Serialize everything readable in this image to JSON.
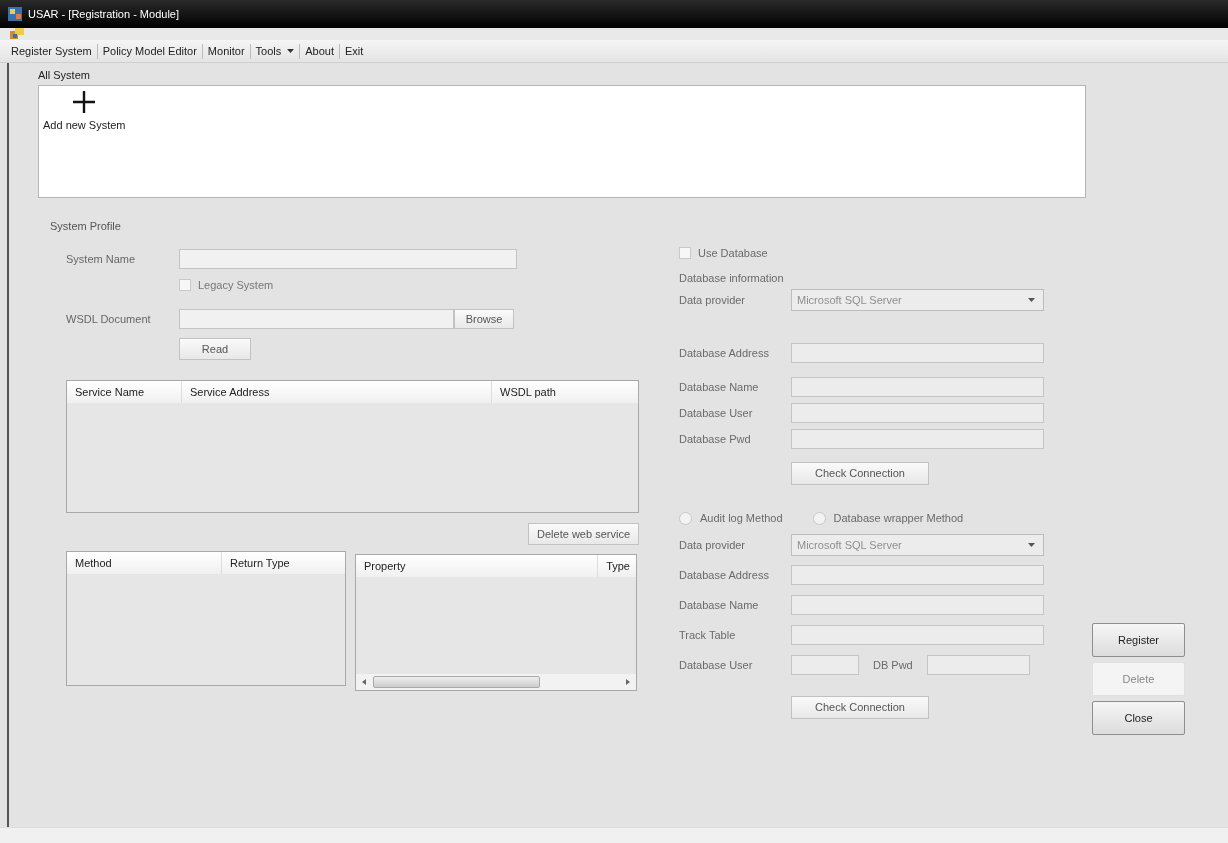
{
  "window": {
    "title": "USAR - [Registration - Module]"
  },
  "menu": [
    {
      "label": "Register System",
      "dropdown": false
    },
    {
      "label": "Policy Model Editor",
      "dropdown": false
    },
    {
      "label": "Monitor",
      "dropdown": false
    },
    {
      "label": "Tools",
      "dropdown": true
    },
    {
      "label": "About",
      "dropdown": false
    },
    {
      "label": "Exit",
      "dropdown": false
    }
  ],
  "all_system": {
    "title": "All System",
    "add_label": "Add new System"
  },
  "system_profile": {
    "title": "System Profile",
    "system_name": {
      "label": "System Name"
    },
    "legacy": {
      "label": "Legacy System",
      "checked": false
    },
    "wsdl": {
      "label": "WSDL Document",
      "browse": "Browse"
    },
    "read_button": "Read",
    "services_table": {
      "columns": [
        "Service Name",
        "Service Address",
        "WSDL path"
      ]
    },
    "delete_service_button": "Delete web service",
    "methods_table": {
      "columns": [
        "Method",
        "Return Type"
      ]
    },
    "properties_table": {
      "columns": [
        "Property",
        "Type"
      ]
    }
  },
  "database": {
    "use_database": {
      "label": "Use Database",
      "checked": false
    },
    "info_title": "Database information",
    "provider": {
      "label": "Data provider",
      "value": "Microsoft SQL Server"
    },
    "fields": [
      "Database Address",
      "Database Name",
      "Database User",
      "Database Pwd"
    ],
    "check_button": "Check Connection"
  },
  "tracking": {
    "methods": [
      {
        "label": "Audit log Method",
        "selected": false
      },
      {
        "label": "Database wrapper Method",
        "selected": false
      }
    ],
    "provider": {
      "label": "Data provider",
      "value": "Microsoft SQL Server"
    },
    "fields": [
      "Database Address",
      "Database Name",
      "Track Table"
    ],
    "user_label": "Database User",
    "pwd_label": "DB Pwd",
    "check_button": "Check Connection"
  },
  "actions": [
    {
      "label": "Register",
      "disabled": false
    },
    {
      "label": "Delete",
      "disabled": true
    },
    {
      "label": "Close",
      "disabled": false
    }
  ]
}
